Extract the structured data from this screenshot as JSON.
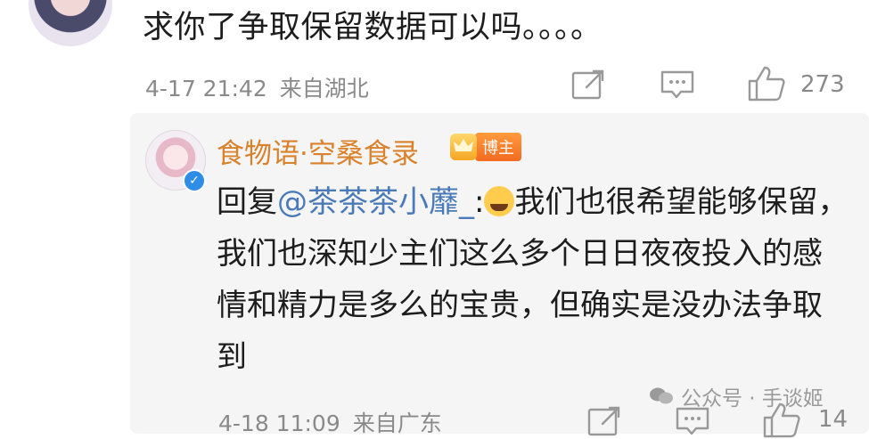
{
  "comment": {
    "text": "求你了争取保留数据可以吗。。。。",
    "time": "4-17 21:42",
    "location": "来自湖北",
    "like_count": "273",
    "icons": [
      "share-icon",
      "comment-icon",
      "like-icon"
    ]
  },
  "reply": {
    "author": "食物语·空桑食录",
    "badge": "博主",
    "prefix": "回复",
    "mention": "@茶茶茶小蘼_",
    "separator": ":",
    "emoji": "crying-face-emoji",
    "body": "我们也很希望能够保留，我们也深知少主们这么多个日日夜夜投入的感情和精力是多么的宝贵，但确实是没办法争取到",
    "time": "4-18 11:09",
    "location": "来自广东",
    "like_count": "14"
  },
  "watermark": {
    "text": "公众号 · 手谈姬"
  },
  "colors": {
    "author": "#d9822b",
    "mention": "#4a7ab8",
    "meta": "#8a8a8a",
    "reply_bg": "#f5f5f5"
  }
}
